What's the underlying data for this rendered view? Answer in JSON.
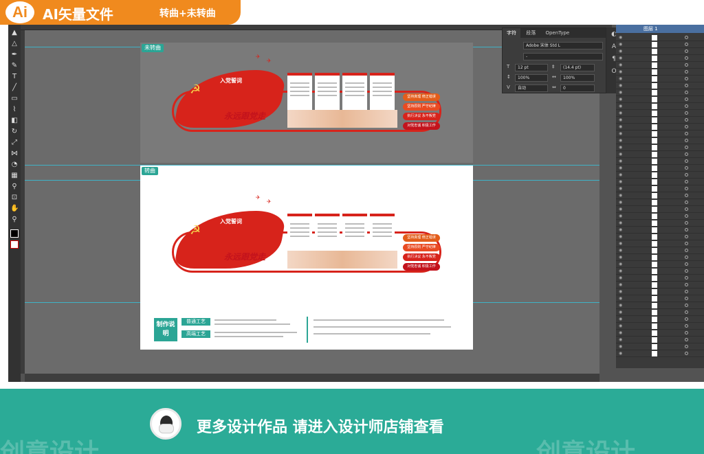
{
  "header": {
    "badge_logo": "Ai",
    "title": "AI矢量文件",
    "subtitle": "转曲+未转曲"
  },
  "toolbar": {
    "icons": [
      "selection-icon",
      "direct-selection-icon",
      "pen-icon",
      "pencil-icon",
      "brush-icon",
      "type-icon",
      "line-icon",
      "rectangle-icon",
      "rotate-icon",
      "scale-icon",
      "eraser-icon",
      "width-icon",
      "shape-builder-icon",
      "gradient-icon",
      "eyedropper-icon",
      "blend-icon",
      "symbol-icon",
      "graph-icon",
      "artboard-icon",
      "slice-icon",
      "hand-icon",
      "zoom-icon"
    ]
  },
  "artboards": {
    "top_label": "未转曲",
    "bottom_label": "转曲"
  },
  "wall": {
    "flag_title": "入党誓词",
    "slogan": "永远跟党走",
    "chips": [
      "坚持真理 修正错误",
      "坚持原则 严守纪律",
      "执行决议 永不叛党",
      "对党忠诚 积极工作"
    ]
  },
  "notes": {
    "box_label": "制作说明",
    "pill1": "普通工艺",
    "pill2": "高端工艺"
  },
  "character_panel": {
    "tabs": [
      "字符",
      "段落",
      "OpenType"
    ],
    "font_family": "Adobe 宋体 Std L",
    "font_style": "-",
    "font_size": "12 pt",
    "leading": "(14.4 pt)",
    "vscale": "100%",
    "hscale": "100%",
    "kerning": "自动",
    "tracking": "0"
  },
  "layers_panel": {
    "layer_name": "图层 1"
  },
  "promo": {
    "text": "更多设计作品 请进入设计师店铺查看",
    "watermark_left": "创意设计",
    "watermark_right": "创意设计"
  }
}
